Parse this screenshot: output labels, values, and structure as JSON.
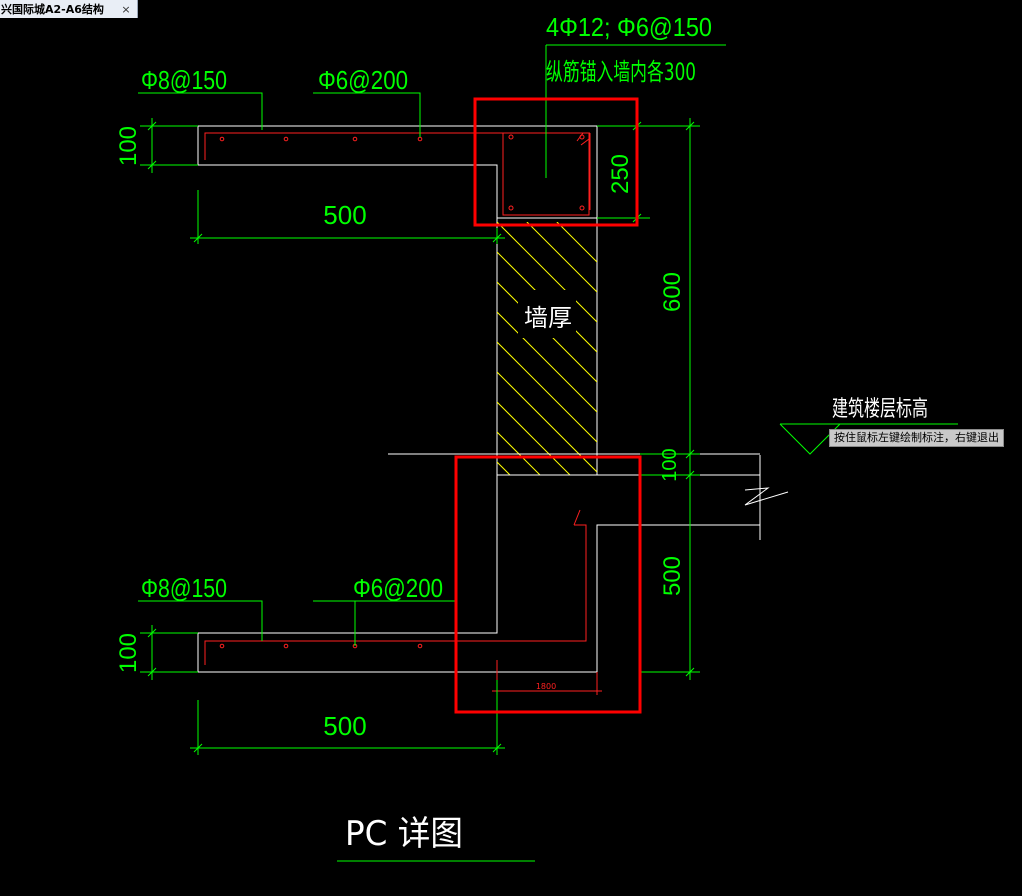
{
  "tab": {
    "title": "兴国际城A2-A6结构",
    "close_label": "×"
  },
  "drawing": {
    "top_rebar_longitudinal": "4Φ12;  Φ6@150",
    "anchor_note": "纵筋锚入墙内各300",
    "top_slab_rebar_main": "Φ8@150",
    "top_slab_rebar_dist": "Φ6@200",
    "dim_top_thickness": "100",
    "dim_top_width": "500",
    "dim_beam_height": "250",
    "dim_wall_height": "600",
    "wall_label": "墙厚",
    "floor_elevation_label": "建筑楼层标高",
    "dim_floor_gap": "100",
    "dim_lower_height": "500",
    "bottom_slab_rebar_main": "Φ8@150",
    "bottom_slab_rebar_dist": "Φ6@200",
    "dim_bottom_thickness": "100",
    "dim_bottom_width": "500",
    "small_dim": "1800",
    "title": "PC 详图"
  },
  "status": {
    "tooltip": "按住鼠标左键绘制标注，右键退出"
  },
  "colors": {
    "background": "#000000",
    "dimension": "#00ff00",
    "rebar": "#ff2020",
    "outline": "#ffffff",
    "hatch": "#ffff00",
    "highlight": "#ff0000"
  }
}
